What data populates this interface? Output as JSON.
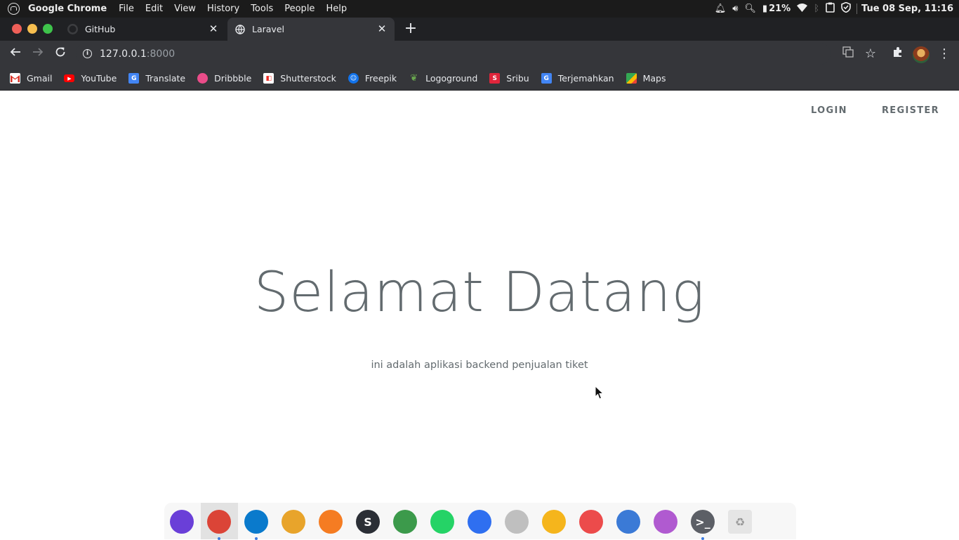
{
  "os_bar": {
    "app_name": "Google Chrome",
    "menu": [
      "File",
      "Edit",
      "View",
      "History",
      "Tools",
      "People",
      "Help"
    ],
    "battery": "21%",
    "clock": "Tue 08 Sep, 11:16"
  },
  "tabs": [
    {
      "title": "GitHub",
      "icon": "github-icon",
      "active": false
    },
    {
      "title": "Laravel",
      "icon": "globe-icon",
      "active": true
    }
  ],
  "toolbar": {
    "url_host": "127.0.0.1",
    "url_port": ":8000"
  },
  "bookmarks": [
    {
      "label": "Gmail",
      "icon": "gmail-icon",
      "color": "#d93025"
    },
    {
      "label": "YouTube",
      "icon": "youtube-icon",
      "color": "#ff0000"
    },
    {
      "label": "Translate",
      "icon": "translate-icon",
      "color": "#4285f4"
    },
    {
      "label": "Dribbble",
      "icon": "dribbble-icon",
      "color": "#ea4c89"
    },
    {
      "label": "Shutterstock",
      "icon": "shutterstock-icon",
      "color": "#ee2b24"
    },
    {
      "label": "Freepik",
      "icon": "freepik-icon",
      "color": "#1273eb"
    },
    {
      "label": "Logoground",
      "icon": "logoground-icon",
      "color": "#6aa84f"
    },
    {
      "label": "Sribu",
      "icon": "sribu-icon",
      "color": "#e0253b"
    },
    {
      "label": "Terjemahkan",
      "icon": "translate-icon",
      "color": "#4285f4"
    },
    {
      "label": "Maps",
      "icon": "maps-icon",
      "color": "#34a853"
    }
  ],
  "page": {
    "login_label": "LOGIN",
    "register_label": "REGISTER",
    "title": "Selamat Datang",
    "subtitle": "ini adalah aplikasi backend penjualan tiket"
  },
  "dock": [
    {
      "name": "app-launcher-icon",
      "color": "#6a3fd8"
    },
    {
      "name": "chrome-icon",
      "color": "#db4437",
      "active": true
    },
    {
      "name": "vscode-icon",
      "color": "#0a7acc"
    },
    {
      "name": "dbeaver-icon",
      "color": "#e8a42b"
    },
    {
      "name": "pencil-app-icon",
      "color": "#f57c22"
    },
    {
      "name": "simplenote-icon",
      "color": "#2b2f36",
      "glyph": "S"
    },
    {
      "name": "layers-icon",
      "color": "#3c9a4b"
    },
    {
      "name": "whatsapp-icon",
      "color": "#25d366"
    },
    {
      "name": "store-icon",
      "color": "#2f6ff0"
    },
    {
      "name": "speaker-icon",
      "color": "#bfbfbf"
    },
    {
      "name": "media-player-icon",
      "color": "#f5b51c"
    },
    {
      "name": "screenshot-icon",
      "color": "#ec4b4b"
    },
    {
      "name": "toggle-app-icon",
      "color": "#3b7ad6"
    },
    {
      "name": "quote-app-icon",
      "color": "#b05ad0"
    },
    {
      "name": "terminal-icon",
      "color": "#5c5f66",
      "glyph": ">_"
    },
    {
      "name": "trash-icon",
      "color": "#e5e5e5"
    }
  ]
}
